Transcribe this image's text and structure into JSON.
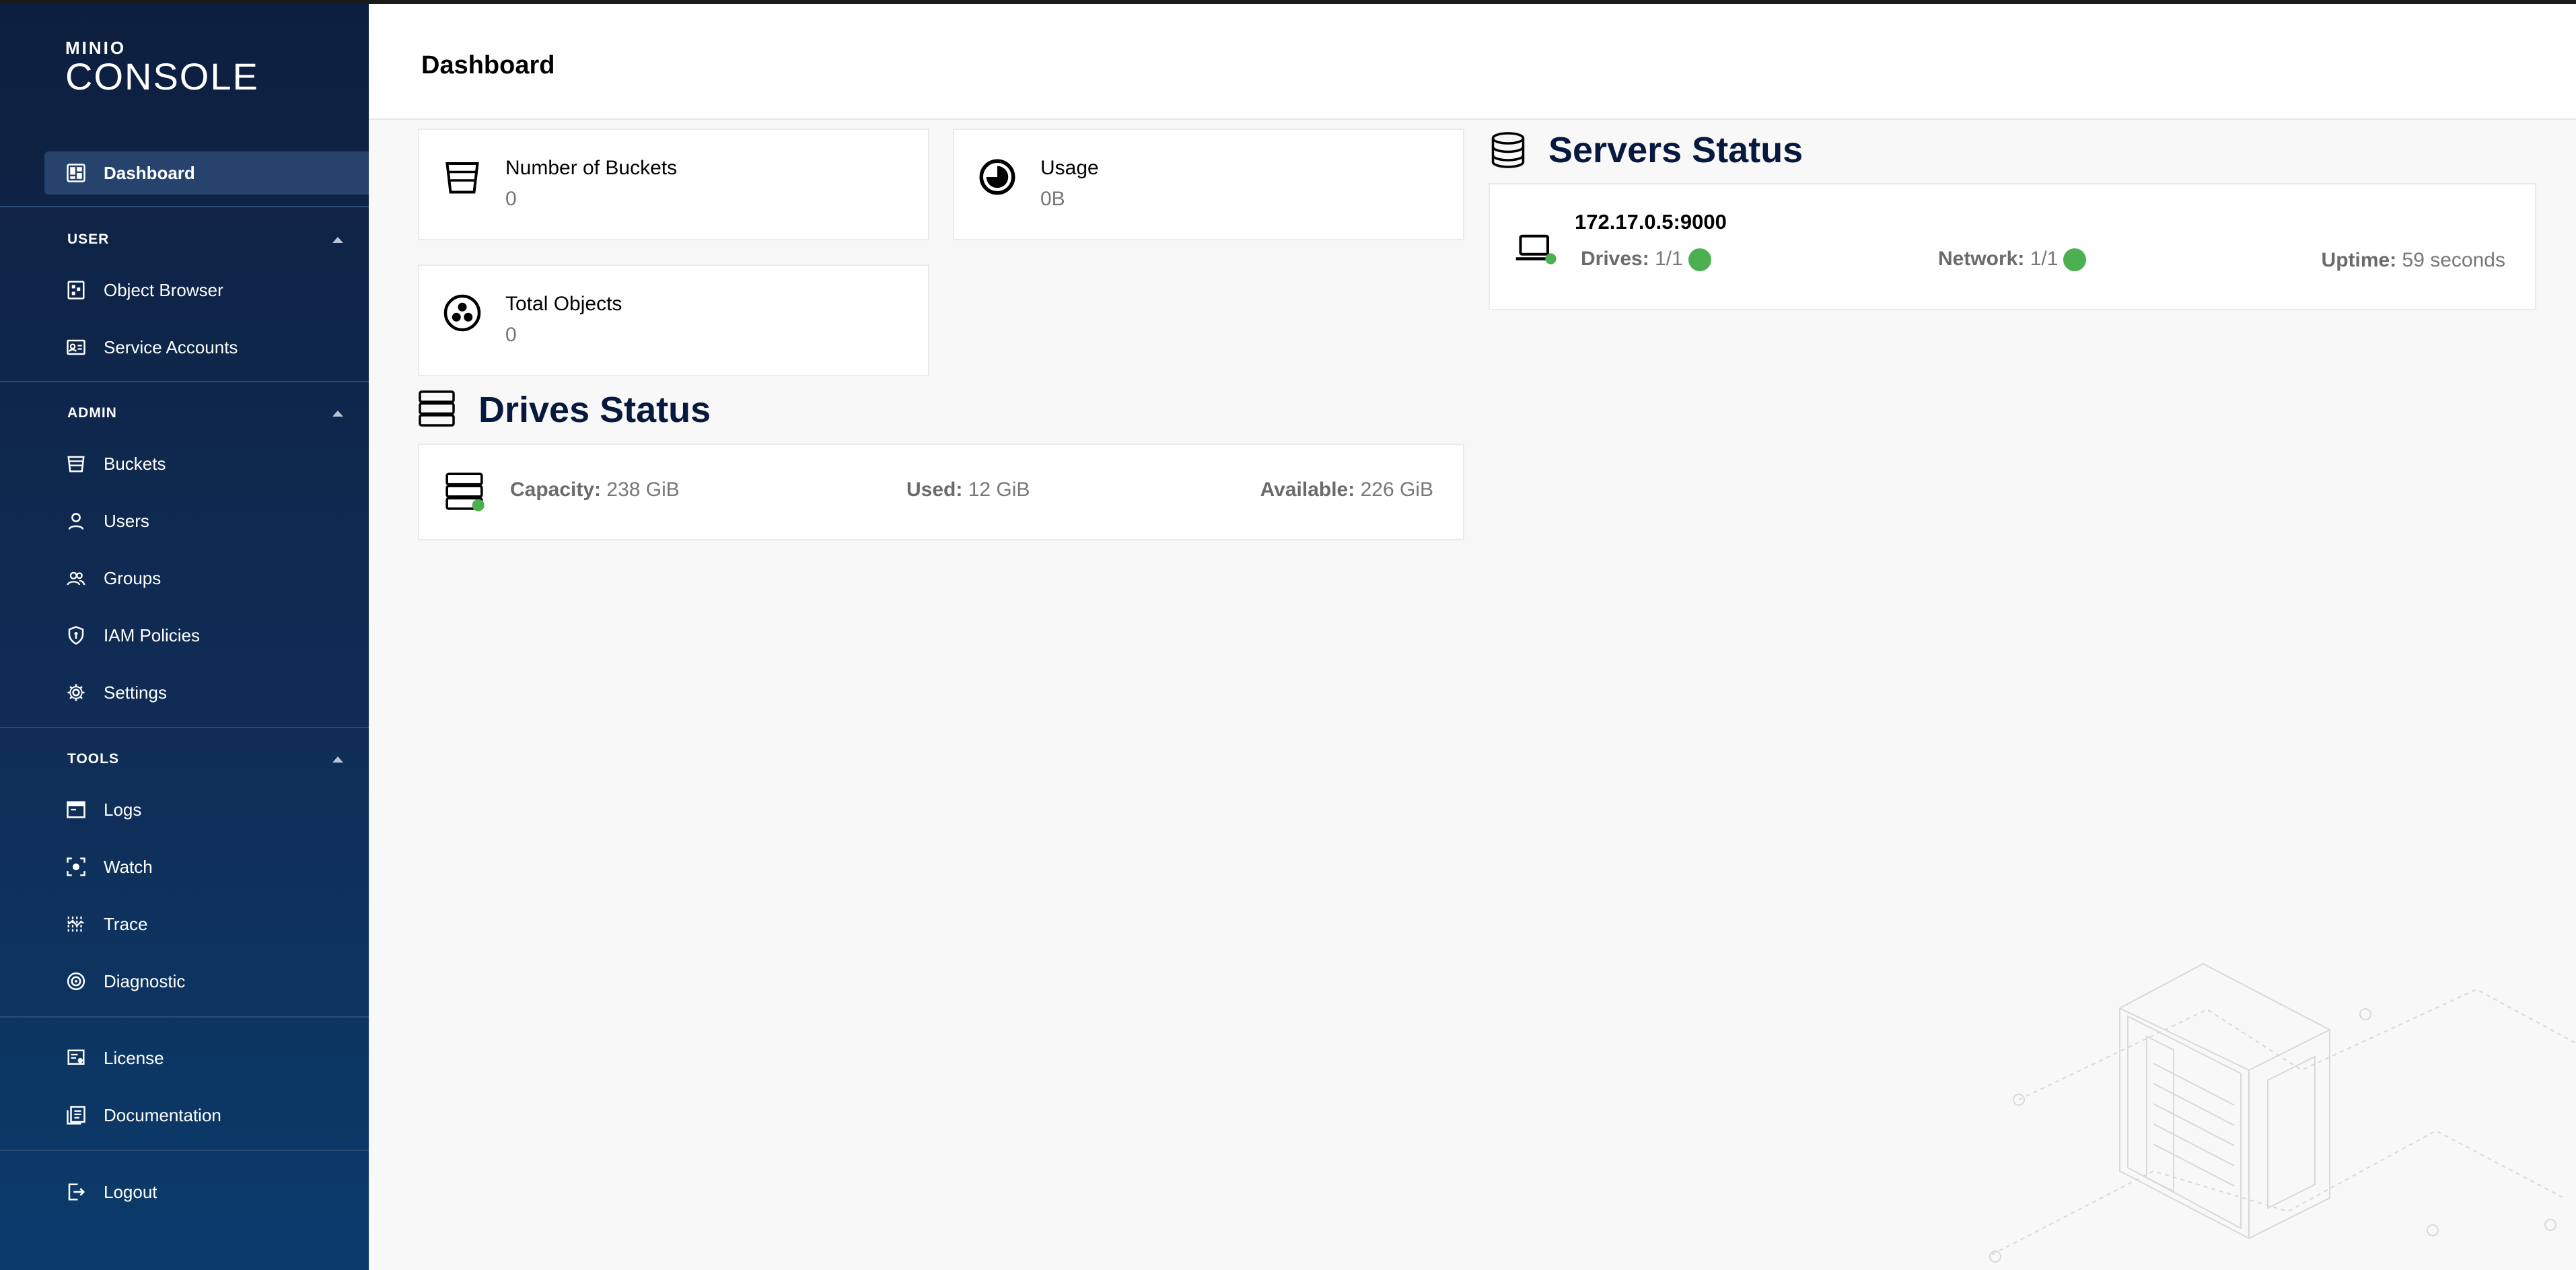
{
  "app": {
    "logo_mini": "MINIO",
    "logo_name": "CONSOLE"
  },
  "sidebar": {
    "dashboard": {
      "label": "Dashboard",
      "icon": "dashboard-icon"
    },
    "sections": [
      {
        "title": "USER",
        "items": [
          {
            "label": "Object Browser",
            "icon": "object-browser-icon"
          },
          {
            "label": "Service Accounts",
            "icon": "service-accounts-icon"
          }
        ]
      },
      {
        "title": "ADMIN",
        "items": [
          {
            "label": "Buckets",
            "icon": "bucket-icon"
          },
          {
            "label": "Users",
            "icon": "user-icon"
          },
          {
            "label": "Groups",
            "icon": "groups-icon"
          },
          {
            "label": "IAM Policies",
            "icon": "shield-icon"
          },
          {
            "label": "Settings",
            "icon": "gear-icon"
          }
        ]
      },
      {
        "title": "TOOLS",
        "items": [
          {
            "label": "Logs",
            "icon": "logs-icon"
          },
          {
            "label": "Watch",
            "icon": "watch-icon"
          },
          {
            "label": "Trace",
            "icon": "trace-icon"
          },
          {
            "label": "Diagnostic",
            "icon": "diagnostic-icon"
          }
        ]
      }
    ],
    "bottom_items": [
      {
        "label": "License",
        "icon": "license-icon"
      },
      {
        "label": "Documentation",
        "icon": "documentation-icon"
      },
      {
        "label": "Logout",
        "icon": "logout-icon"
      }
    ]
  },
  "header": {
    "title": "Dashboard"
  },
  "stats": {
    "buckets": {
      "label": "Number of Buckets",
      "value": "0"
    },
    "usage": {
      "label": "Usage",
      "value": "0B"
    },
    "objects": {
      "label": "Total Objects",
      "value": "0"
    }
  },
  "drives_status": {
    "title": "Drives Status",
    "capacity_label": "Capacity:",
    "capacity_value": "238 GiB",
    "used_label": "Used:",
    "used_value": "12 GiB",
    "available_label": "Available:",
    "available_value": "226 GiB",
    "status_color": "#4caf50"
  },
  "servers_status": {
    "title": "Servers Status",
    "server": {
      "host": "172.17.0.5:9000",
      "drives_label": "Drives:",
      "drives_value": "1/1",
      "network_label": "Network:",
      "network_value": "1/1",
      "uptime_label": "Uptime:",
      "uptime_value": "59 seconds"
    },
    "status_color": "#4caf50"
  },
  "colors": {
    "sidebar_bg": "#0d1f3f",
    "active_item": "#25436d",
    "heading": "#07193e",
    "ok": "#4caf50"
  }
}
